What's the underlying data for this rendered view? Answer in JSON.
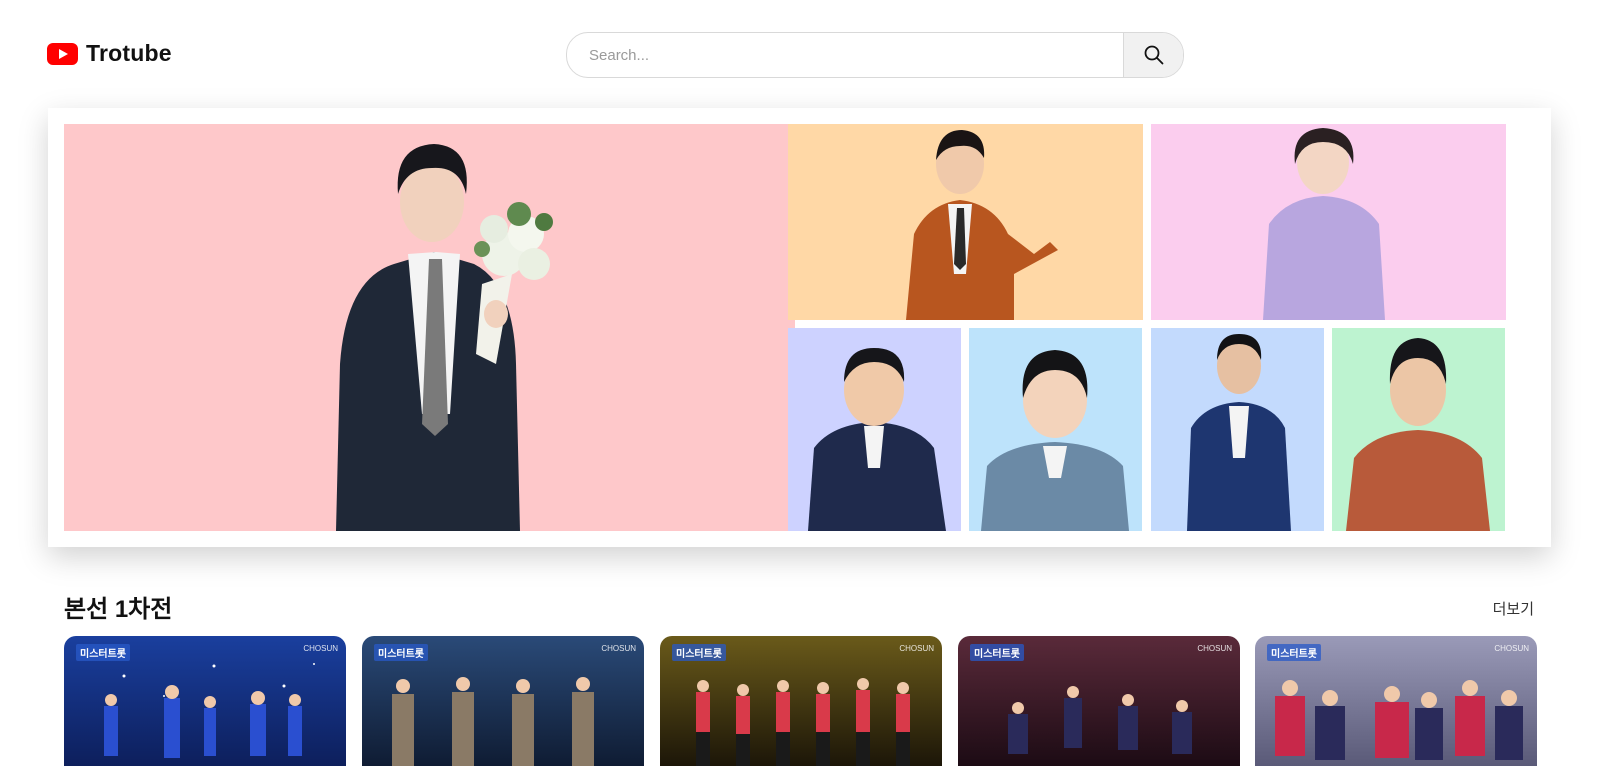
{
  "header": {
    "logo_text": "Trotube",
    "search_placeholder": "Search..."
  },
  "banner": {
    "tiles": [
      {
        "name": "featured-singer",
        "bg": "#fec8ca"
      },
      {
        "name": "singer-orange",
        "bg": "#ffd8a6"
      },
      {
        "name": "singer-pink",
        "bg": "#fbcdee"
      },
      {
        "name": "singer-lavender",
        "bg": "#cdd2ff"
      },
      {
        "name": "singer-skyblue",
        "bg": "#bde3fb"
      },
      {
        "name": "singer-blue",
        "bg": "#c3dafd"
      },
      {
        "name": "singer-mint",
        "bg": "#bdf3d0"
      }
    ]
  },
  "section": {
    "title": "본선 1차전",
    "more_label": "더보기"
  },
  "videos": [
    {
      "show_logo": "미스터트롯",
      "channel": "CHOSUN",
      "colors": [
        "#1a3f9e",
        "#0d1f5c"
      ]
    },
    {
      "show_logo": "미스터트롯",
      "channel": "CHOSUN",
      "colors": [
        "#2a4a78",
        "#0f1c33"
      ]
    },
    {
      "show_logo": "미스터트롯",
      "channel": "CHOSUN",
      "colors": [
        "#6a5a1a",
        "#1c1608"
      ]
    },
    {
      "show_logo": "미스터트롯",
      "channel": "CHOSUN",
      "colors": [
        "#5a2a3a",
        "#1c0b14"
      ]
    },
    {
      "show_logo": "미스터트롯",
      "channel": "CHOSUN",
      "colors": [
        "#9a9ab8",
        "#5a5a78"
      ]
    }
  ],
  "icons": {
    "logo": "youtube-play-icon",
    "search": "search-icon"
  }
}
